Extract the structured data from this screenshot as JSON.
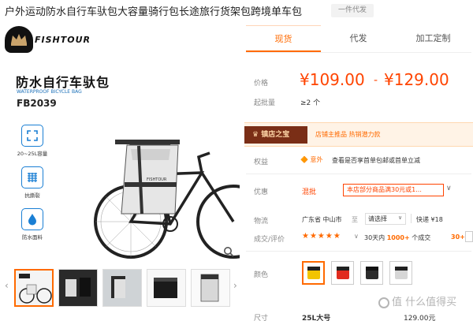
{
  "product": {
    "title": "户外运动防水自行车驮包大容量骑行包长途旅行货架包跨境单车包",
    "badge": "一件代发"
  },
  "image_panel": {
    "brand": "FISHTOUR",
    "heading": "防水自行车驮包",
    "subheading": "WATERPROOF BICYCLE BAG",
    "model": "FB2039",
    "features": [
      "20~25L容量",
      "抗撕裂",
      "防水面料"
    ],
    "icons": [
      "expand-icon",
      "fabric-icon",
      "droplet-icon",
      "zoom-icon"
    ]
  },
  "thumbnails": {
    "prev": "‹",
    "next": "›",
    "items": [
      "thumb-1",
      "thumb-2",
      "thumb-3",
      "thumb-4",
      "thumb-5"
    ]
  },
  "tabs": [
    {
      "label": "现货",
      "active": true
    },
    {
      "label": "代发",
      "active": false
    },
    {
      "label": "加工定制",
      "active": false
    }
  ],
  "pricing": {
    "price_label": "价格",
    "price_low": "¥109.00",
    "dash": "-",
    "price_high": "¥129.00",
    "moq_label": "起批量",
    "moq_value": "≥2 个"
  },
  "promo": {
    "badge": "镇店之宝",
    "text": "店铺主推品  热销潜力款"
  },
  "benefits": {
    "label": "权益",
    "tag": "🔶 意外",
    "text": "查看是否享首单包邮或首单立减"
  },
  "discount": {
    "label": "优惠",
    "type": "混批",
    "box": "本店部分商品满30元或1...",
    "chevron": "∨"
  },
  "shipping": {
    "label": "物流",
    "from": "广东省 中山市",
    "to_word": "至",
    "select_value": "请选择",
    "select_chevron": "∨",
    "express": "快递  ¥18"
  },
  "evaluation": {
    "label": "成交/评价",
    "stars": "★★★★★",
    "stars_value": 5,
    "chevron": "∨",
    "deal_prefix": "30天内",
    "deal_count": "1000+",
    "deal_suffix": "个成交",
    "review_count": "30+"
  },
  "color": {
    "label": "颜色",
    "options": [
      {
        "name": "yellow",
        "hex": "#f2c400",
        "selected": true
      },
      {
        "name": "red",
        "hex": "#e12b1e",
        "selected": false
      },
      {
        "name": "black",
        "hex": "#2b2b2b",
        "selected": false
      },
      {
        "name": "gray",
        "hex": "#d6d6d6",
        "selected": false
      }
    ]
  },
  "size": {
    "label": "尺寸",
    "value": "25L大号",
    "price": "129.00元"
  },
  "watermark": "值 什么值得买",
  "colors": {
    "accent": "#ff6a00",
    "price": "#ff4400",
    "promo_badge_bg": "#7a2e16",
    "promo_bar_bg": "#fff3e6",
    "feature_blue": "#1a7fd4"
  }
}
